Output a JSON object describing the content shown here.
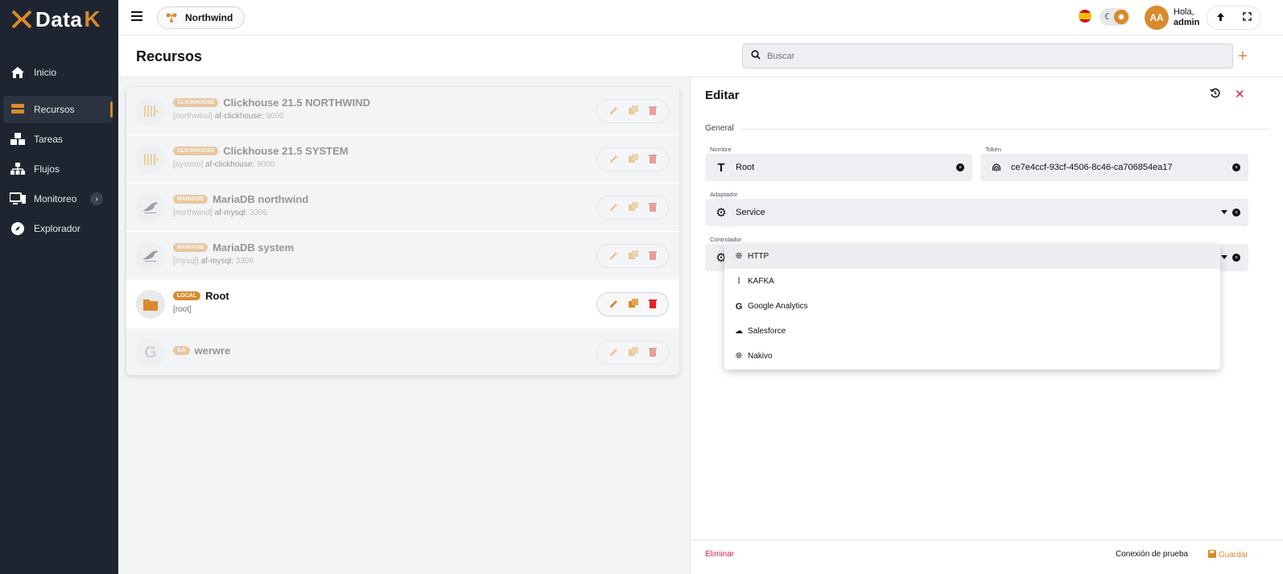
{
  "app": {
    "logo_text": "Data",
    "logo_suffix": "K"
  },
  "colors": {
    "accent": "#d98b2b",
    "sidebar_bg": "#1f2530",
    "danger": "#e11d48"
  },
  "sidebar": {
    "items": [
      {
        "label": "Inicio",
        "icon": "home-icon"
      },
      {
        "label": "Recursos",
        "icon": "database-icon",
        "active": true
      },
      {
        "label": "Tareas",
        "icon": "boxes-icon"
      },
      {
        "label": "Flujos",
        "icon": "sitemap-icon"
      },
      {
        "label": "Monitoreo",
        "icon": "monitor-icon"
      },
      {
        "label": "Explorador",
        "icon": "compass-icon"
      }
    ]
  },
  "topbar": {
    "project": "Northwind",
    "avatar_initials": "AA",
    "greeting": "Hola,",
    "username": "admin"
  },
  "page": {
    "title": "Recursos",
    "search_placeholder": "Buscar"
  },
  "resources": [
    {
      "badge": "CLICKHOUSE",
      "name": "Clickhouse 21.5 NORTHWIND",
      "bracket": "[northwind]",
      "adapter": "af-clickhouse:",
      "port": "9000",
      "icon": "clickhouse-icon"
    },
    {
      "badge": "CLICKHOUSE",
      "name": "Clickhouse 21.5 SYSTEM",
      "bracket": "[system]",
      "adapter": "af-clickhouse:",
      "port": "9000",
      "icon": "clickhouse-icon"
    },
    {
      "badge": "MARIADB",
      "name": "MariaDB northwind",
      "bracket": "[northwind]",
      "adapter": "af-mysql:",
      "port": "3306",
      "icon": "mariadb-icon"
    },
    {
      "badge": "MARIADB",
      "name": "MariaDB system",
      "bracket": "[mysql]",
      "adapter": "af-mysql:",
      "port": "3306",
      "icon": "mariadb-icon"
    },
    {
      "badge": "LOCAL",
      "name": "Root",
      "bracket": "[root]",
      "adapter": "",
      "port": "",
      "icon": "folder-icon",
      "selected": true
    },
    {
      "badge": "GA",
      "name": "werwre",
      "bracket": "",
      "adapter": "",
      "port": "",
      "icon": "google-icon"
    }
  ],
  "edit": {
    "title": "Editar",
    "section": "General",
    "name_label": "Nombre",
    "name_value": "Root",
    "token_label": "Token",
    "token_value": "ce7e4ccf-93cf-4506-8c46-ca706854ea17",
    "adapter_label": "Adaptador",
    "adapter_value": "Service",
    "controller_label": "Controlador",
    "controller_options": [
      {
        "label": "HTTP",
        "icon": "globe-icon",
        "selected": true
      },
      {
        "label": "KAFKA",
        "icon": "kafka-icon"
      },
      {
        "label": "Google Analytics",
        "icon": "google-icon"
      },
      {
        "label": "Salesforce",
        "icon": "salesforce-icon"
      },
      {
        "label": "Nakivo",
        "icon": "globe-icon"
      }
    ],
    "delete_label": "Eliminar",
    "test_label": "Conexión de prueba",
    "save_label": "Guardar"
  }
}
